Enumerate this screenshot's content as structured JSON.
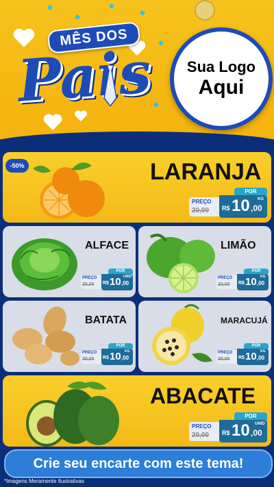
{
  "hero": {
    "badge": "MÊS DOS",
    "title": "Pais",
    "logo_line1": "Sua Logo",
    "logo_line2": "Aqui"
  },
  "discount_badge": "-50%",
  "products": [
    {
      "name": "LARANJA",
      "por": "POR",
      "preco": "PREÇO",
      "old_price": "20,00",
      "currency": "R$",
      "price_int": "10",
      "price_cents": ",00",
      "unit": "KG"
    },
    {
      "name": "ALFACE",
      "por": "POR",
      "preco": "PREÇO",
      "old_price": "20,00",
      "currency": "R$",
      "price_int": "10",
      "price_cents": ",00",
      "unit": "UNID"
    },
    {
      "name": "LIMÃO",
      "por": "POR",
      "preco": "PREÇO",
      "old_price": "20,00",
      "currency": "R$",
      "price_int": "10",
      "price_cents": ",00",
      "unit": "KG"
    },
    {
      "name": "BATATA",
      "por": "POR",
      "preco": "PREÇO",
      "old_price": "20,00",
      "currency": "R$",
      "price_int": "10",
      "price_cents": ",00",
      "unit": "KG"
    },
    {
      "name": "MARACUJÁ",
      "por": "POR",
      "preco": "PREÇO",
      "old_price": "20,00",
      "currency": "R$",
      "price_int": "10",
      "price_cents": ",00",
      "unit": "KG"
    },
    {
      "name": "ABACATE",
      "por": "POR",
      "preco": "PREÇO",
      "old_price": "20,00",
      "currency": "R$",
      "price_int": "10",
      "price_cents": ",00",
      "unit": "UNID"
    }
  ],
  "cta": "Crie seu encarte com este tema!",
  "footnote": "*Imagens Meramente Ilustrativas",
  "colors": {
    "yellow": "#f5b20d",
    "navy": "#0b2e7a",
    "blue": "#1d4bb8",
    "price_bg": "#1f6b9a",
    "cta": "#2c7ed8"
  }
}
